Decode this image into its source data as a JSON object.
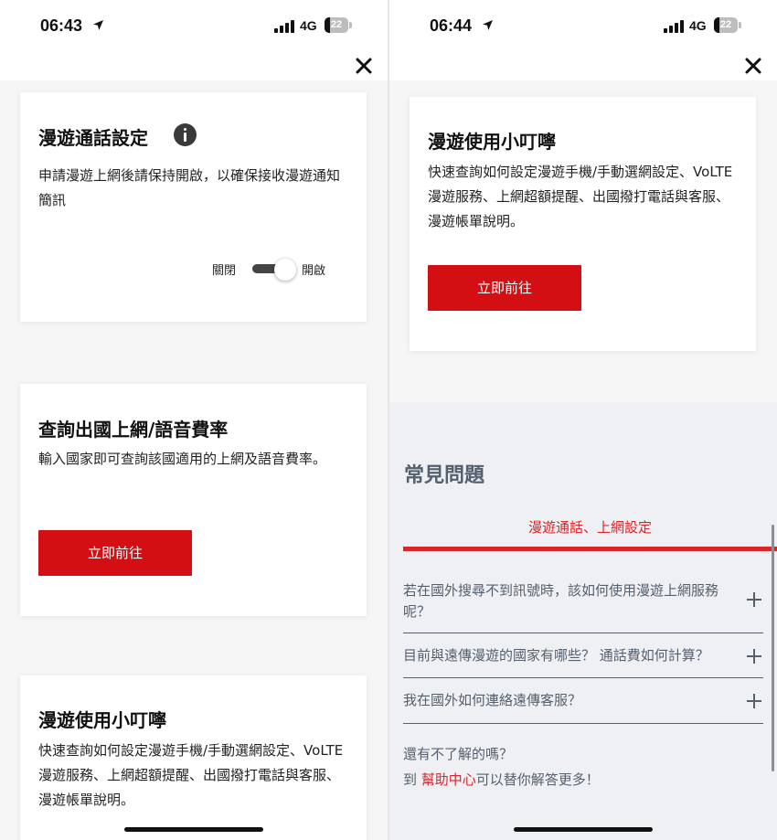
{
  "left": {
    "status": {
      "time": "06:43",
      "network": "4G",
      "battery": "22",
      "battery_level": 0.22
    },
    "card_roaming": {
      "title": "漫遊通話設定",
      "desc": "申請漫遊上網後請保持開啟，以確保接收漫遊通知簡訊",
      "toggle_off_label": "關閉",
      "toggle_on_label": "開啟",
      "toggle_state": "on"
    },
    "card_rates": {
      "title": "查詢出國上網/語音費率",
      "desc": "輸入國家即可查詢該國適用的上網及語音費率。",
      "button": "立即前往"
    },
    "card_tips": {
      "title": "漫遊使用小叮嚀",
      "desc": "快速查詢如何設定漫遊手機/手動選網設定、VoLTE漫遊服務、上網超額提醒、出國撥打電話與客服、漫遊帳單說明。"
    }
  },
  "right": {
    "status": {
      "time": "06:44",
      "network": "4G",
      "battery": "22",
      "battery_level": 0.22
    },
    "card_tips": {
      "title": "漫遊使用小叮嚀",
      "desc": "快速查詢如何設定漫遊手機/手動選網設定、VoLTE漫遊服務、上網超額提醒、出國撥打電話與客服、漫遊帳單說明。",
      "button": "立即前往"
    },
    "faq": {
      "title": "常見問題",
      "tab": "漫遊通話、上網設定",
      "items": [
        "若在國外搜尋不到訊號時，該如何使用漫遊上網服務呢？",
        "目前與遠傳漫遊的國家有哪些？ 通話費如何計算？",
        "我在國外如何連絡遠傳客服？"
      ],
      "footer_line1": "還有不了解的嗎？",
      "footer_prefix": "到 ",
      "footer_link": "幫助中心",
      "footer_suffix": "可以替你解答更多！"
    }
  },
  "colors": {
    "accent": "#d40f14",
    "faq_text": "#55606e",
    "faq_bg": "#eef0f3"
  },
  "icons": [
    "location-arrow-icon",
    "signal-icon",
    "battery-icon",
    "close-icon",
    "info-icon",
    "plus-icon"
  ]
}
